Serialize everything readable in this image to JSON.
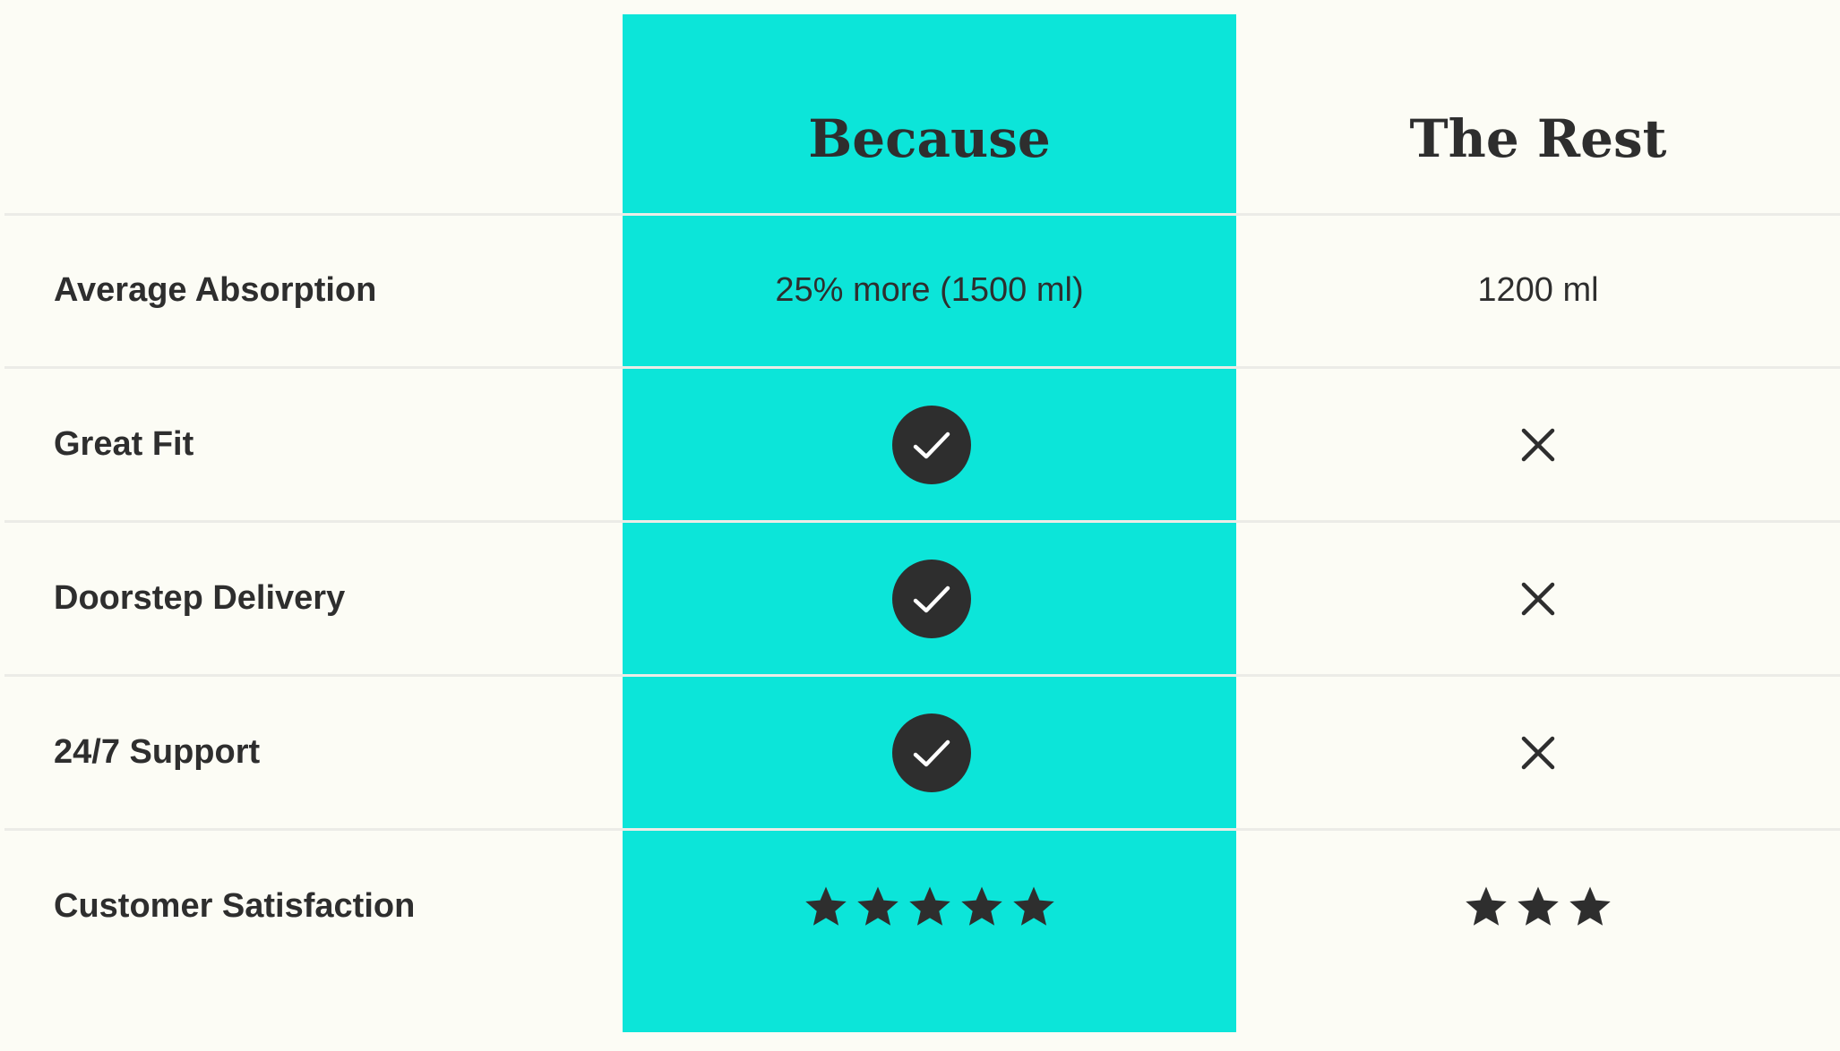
{
  "table": {
    "columns": {
      "because": "Because",
      "rest": "The Rest"
    },
    "rows": [
      {
        "label": "Average Absorption",
        "because": "25% more (1500 ml)",
        "rest": "1200 ml"
      },
      {
        "label": "Great Fit",
        "because_icon": "check-icon",
        "rest_icon": "cross-icon"
      },
      {
        "label": "Doorstep Delivery",
        "because_icon": "check-icon",
        "rest_icon": "cross-icon"
      },
      {
        "label": "24/7 Support",
        "because_icon": "check-icon",
        "rest_icon": "cross-icon"
      },
      {
        "label": "Customer Satisfaction",
        "because_stars": 5,
        "rest_stars": 3
      }
    ]
  },
  "colors": {
    "background": "#fcfcf5",
    "highlight": "#0ce5d9",
    "text": "#2e2e2e",
    "divider": "#ecece7"
  }
}
